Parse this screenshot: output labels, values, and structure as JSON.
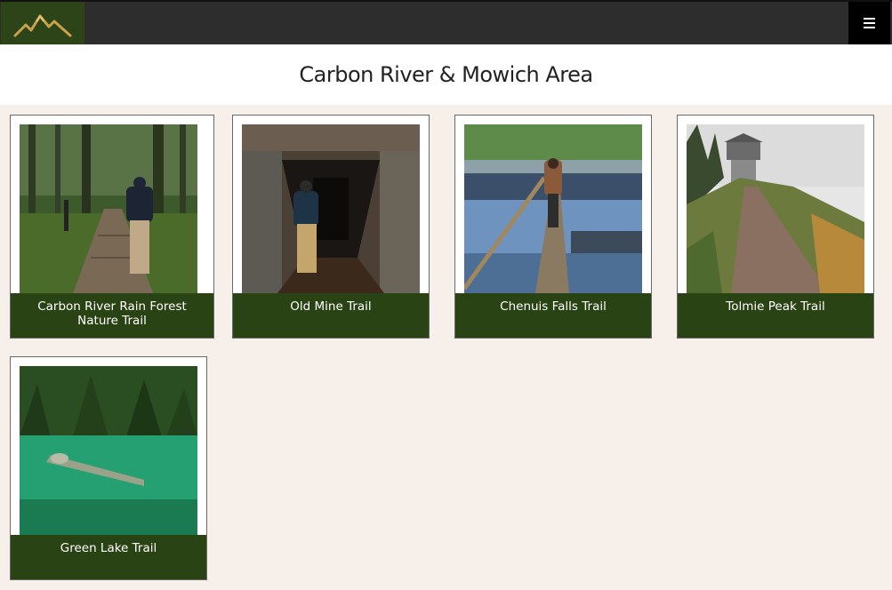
{
  "header": {
    "logo_icon": "mountain-logo-icon",
    "menu_icon": "hamburger-menu-icon"
  },
  "page": {
    "title": "Carbon River & Mowich Area"
  },
  "trails": [
    {
      "name": "Carbon River Rain Forest Nature Trail",
      "photo": "forest boardwalk"
    },
    {
      "name": "Old Mine Trail",
      "photo": "mine tunnel"
    },
    {
      "name": "Chenuis Falls Trail",
      "photo": "log bridge over river"
    },
    {
      "name": "Tolmie Peak Trail",
      "photo": "foggy lookout tower"
    },
    {
      "name": "Green Lake Trail",
      "photo": "green lake with submerged log"
    }
  ],
  "colors": {
    "navbar": "#2d2d2d",
    "logo_bg": "#2d4419",
    "caption_bg": "#2a4314",
    "content_bg": "#f7f0ea",
    "logo_gold": "#c9a24a"
  }
}
